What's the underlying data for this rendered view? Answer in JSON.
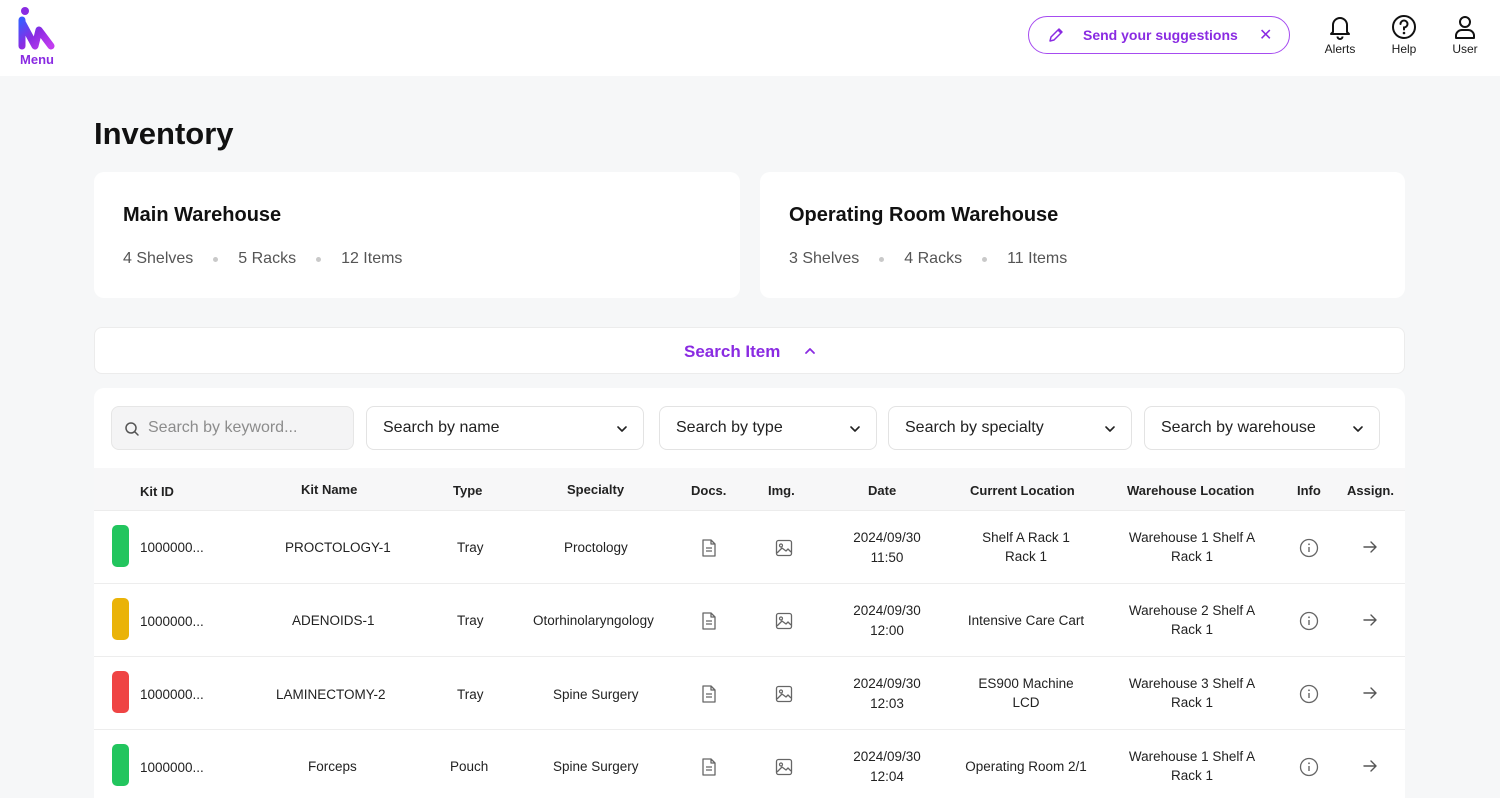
{
  "app": {
    "menu_label": "Menu"
  },
  "header": {
    "suggestion_label": "Send your suggestions",
    "alerts_label": "Alerts",
    "help_label": "Help",
    "user_label": "User"
  },
  "page": {
    "title": "Inventory"
  },
  "warehouses": [
    {
      "name": "Main Warehouse",
      "shelves": "4 Shelves",
      "racks": "5 Racks",
      "items": "12 Items"
    },
    {
      "name": "Operating Room Warehouse",
      "shelves": "3 Shelves",
      "racks": "4 Racks",
      "items": "11 Items"
    }
  ],
  "search": {
    "toggle_label": "Search Item",
    "keyword_placeholder": "Search by keyword...",
    "name_select": "Search by name",
    "type_select": "Search by type",
    "specialty_select": "Search by specialty",
    "warehouse_select": "Search by warehouse"
  },
  "table": {
    "columns": {
      "kit_id": "Kit ID",
      "kit_name": "Kit Name",
      "type": "Type",
      "specialty": "Specialty",
      "docs": "Docs.",
      "img": "Img.",
      "date": "Date",
      "current_location": "Current Location",
      "warehouse_location": "Warehouse Location",
      "info": "Info",
      "assign": "Assign."
    },
    "rows": [
      {
        "status_color": "#22c55e",
        "kit_id": "1000000...",
        "kit_name": "PROCTOLOGY-1",
        "type": "Tray",
        "specialty": "Proctology",
        "date_line1": "2024/09/30",
        "date_line2": "11:50",
        "current_location_line1": "Shelf A Rack 1",
        "current_location_line2": "Rack 1",
        "warehouse_location_line1": "Warehouse 1 Shelf A",
        "warehouse_location_line2": "Rack 1"
      },
      {
        "status_color": "#eab308",
        "kit_id": "1000000...",
        "kit_name": "ADENOIDS-1",
        "type": "Tray",
        "specialty": "Otorhinolaryngology",
        "date_line1": "2024/09/30",
        "date_line2": "12:00",
        "current_location_line1": "Intensive Care Cart",
        "current_location_line2": "",
        "warehouse_location_line1": "Warehouse 2 Shelf A",
        "warehouse_location_line2": "Rack 1"
      },
      {
        "status_color": "#ef4444",
        "kit_id": "1000000...",
        "kit_name": "LAMINECTOMY-2",
        "type": "Tray",
        "specialty": "Spine Surgery",
        "date_line1": "2024/09/30",
        "date_line2": "12:03",
        "current_location_line1": "ES900 Machine",
        "current_location_line2": "LCD",
        "warehouse_location_line1": "Warehouse 3 Shelf A",
        "warehouse_location_line2": "Rack 1"
      },
      {
        "status_color": "#22c55e",
        "kit_id": "1000000...",
        "kit_name": "Forceps",
        "type": "Pouch",
        "specialty": "Spine Surgery",
        "date_line1": "2024/09/30",
        "date_line2": "12:04",
        "current_location_line1": "Operating Room 2/1",
        "current_location_line2": "",
        "warehouse_location_line1": "Warehouse 1 Shelf A",
        "warehouse_location_line2": "Rack 1"
      }
    ]
  },
  "colors": {
    "accent": "#8a2be2",
    "background": "#f6f7f8"
  }
}
